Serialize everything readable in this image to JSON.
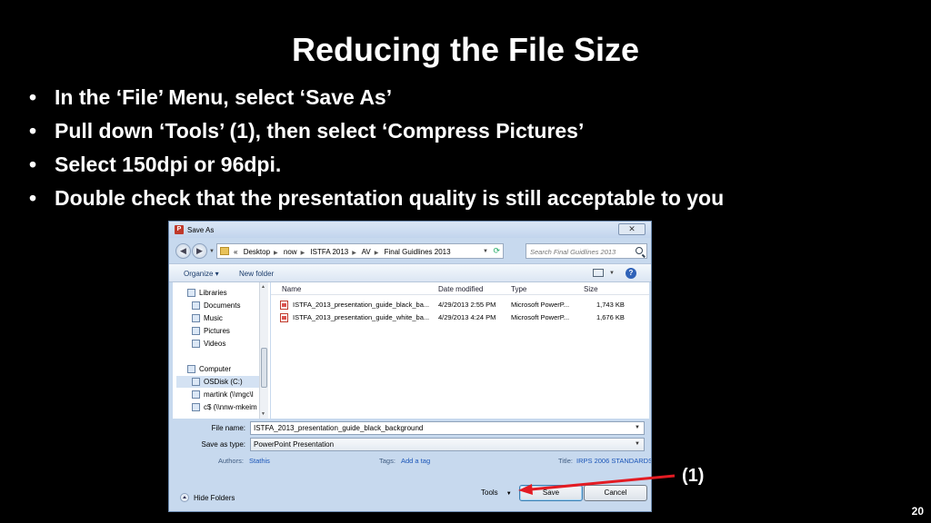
{
  "slide": {
    "title": "Reducing the File Size",
    "bullets": [
      "In the ‘File’ Menu, select ‘Save As’",
      "Pull down ‘Tools’ (1), then select ‘Compress Pictures’",
      "Select 150dpi or 96dpi.",
      "Double check that the presentation quality is still acceptable to you"
    ],
    "callout": "(1)",
    "page_number": "20",
    "callout_color": "#e31b23"
  },
  "dialog": {
    "title": "Save As",
    "app_icon": "P",
    "close": "✕",
    "breadcrumb": [
      "«",
      "Desktop",
      "now",
      "ISTFA 2013",
      "AV",
      "Final Guidlines 2013"
    ],
    "search_placeholder": "Search Final Guidlines 2013",
    "toolbar": {
      "organize": "Organize ▾",
      "new_folder": "New folder",
      "help": "?"
    },
    "nav": {
      "libraries": "Libraries",
      "documents": "Documents",
      "music": "Music",
      "pictures": "Pictures",
      "videos": "Videos",
      "computer": "Computer",
      "osdisk": "OSDisk (C:)",
      "martink": "martink (\\\\mgc\\l",
      "share": "c$ (\\\\nnw-mkeim"
    },
    "columns": {
      "name": "Name",
      "date": "Date modified",
      "type": "Type",
      "size": "Size"
    },
    "files": [
      {
        "name": "ISTFA_2013_presentation_guide_black_ba...",
        "date": "4/29/2013 2:55 PM",
        "type": "Microsoft PowerP...",
        "size": "1,743 KB"
      },
      {
        "name": "ISTFA_2013_presentation_guide_white_ba...",
        "date": "4/29/2013 4:24 PM",
        "type": "Microsoft PowerP...",
        "size": "1,676 KB"
      }
    ],
    "form": {
      "file_name_label": "File name:",
      "file_name_value": "ISTFA_2013_presentation_guide_black_background",
      "save_type_label": "Save as type:",
      "save_type_value": "PowerPoint Presentation"
    },
    "meta": {
      "authors_label": "Authors:",
      "authors_value": "Stathis",
      "tags_label": "Tags:",
      "tags_value": "Add a tag",
      "title_label": "Title:",
      "title_value": "IRPS 2006 STANDARDS FO..."
    },
    "bottom": {
      "hide_folders": "Hide Folders",
      "tools": "Tools",
      "save": "Save",
      "cancel": "Cancel"
    }
  }
}
